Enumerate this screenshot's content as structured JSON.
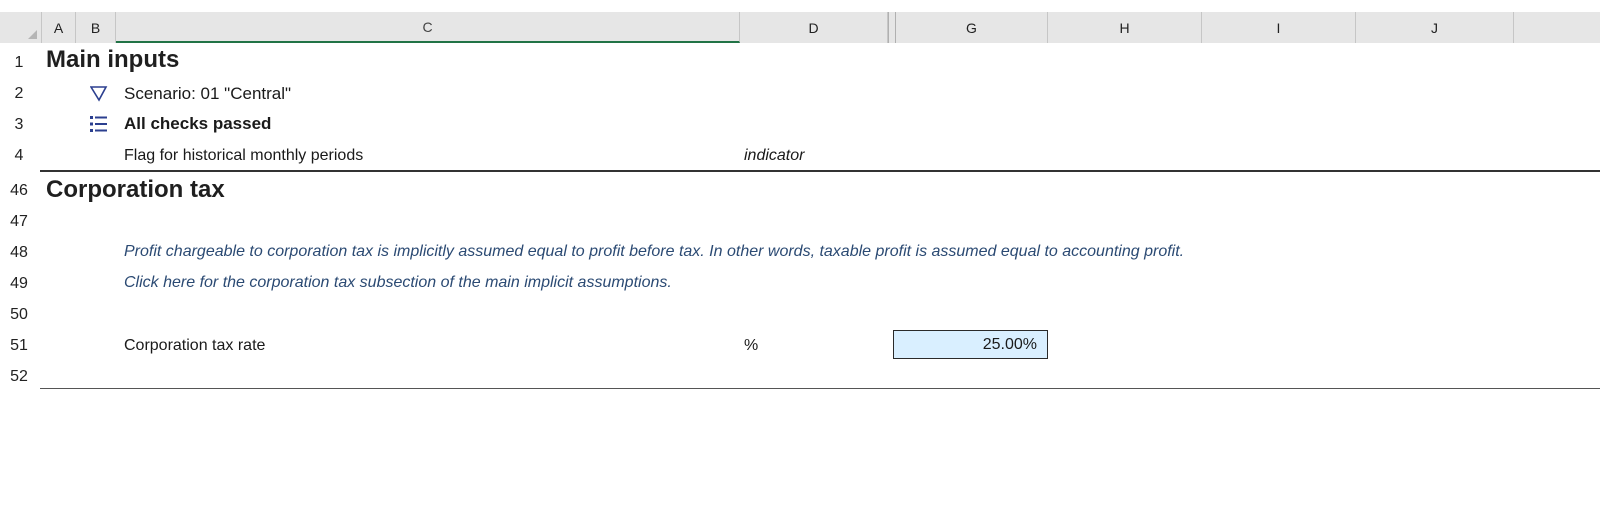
{
  "columns": [
    "A",
    "B",
    "C",
    "D",
    "G",
    "H",
    "I",
    "J"
  ],
  "rows": [
    "1",
    "2",
    "3",
    "4",
    "46",
    "47",
    "48",
    "49",
    "50",
    "51",
    "52"
  ],
  "sections": {
    "main_inputs": {
      "title": "Main inputs",
      "scenario": "Scenario: 01 \"Central\"",
      "checks": "All checks passed",
      "flag_label": "Flag for historical monthly periods",
      "flag_unit": "indicator"
    },
    "corporation_tax": {
      "title": "Corporation tax",
      "note_line1": "Profit chargeable to corporation tax is implicitly assumed equal to profit before tax. In other words, taxable profit is assumed equal to accounting profit.",
      "note_line2": "Click here for the corporation tax subsection of the main implicit assumptions.",
      "rate_label": "Corporation tax rate",
      "rate_unit": "%",
      "rate_value": "25.00%"
    }
  },
  "icons": {
    "scenario": "filter-check-icon",
    "checks": "list-icon"
  },
  "colors": {
    "input_fill": "#d9efff",
    "note_text": "#2b4a73",
    "selected_column_border": "#217346"
  }
}
